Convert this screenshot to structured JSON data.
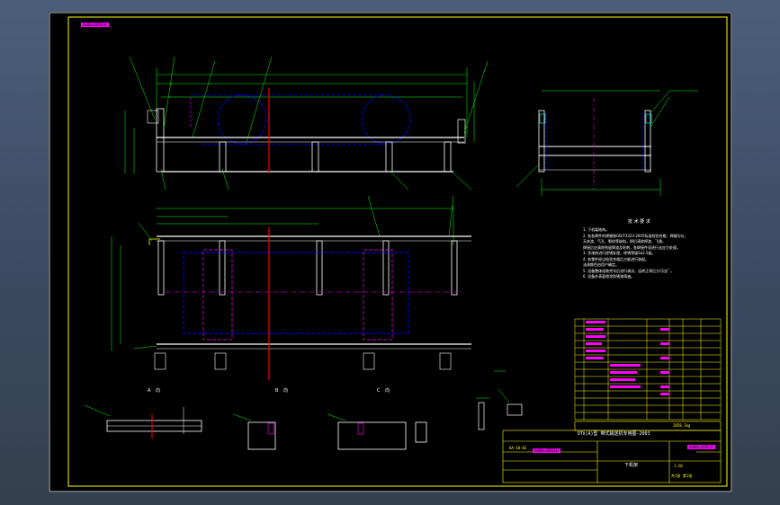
{
  "drawing": {
    "stamp_top_left": "BOOKLINTECH",
    "stamp_bottom_left": "BOOKLINTECH",
    "stamp_title_right": "BOOKLINTECH",
    "stamp_small_left": "6A-10-02",
    "tech_requirements_title": "技 术 要 求",
    "tech_requirements": [
      "1. 下机架结构。",
      "2. 各各焊件的焊缝按GB/T3323-2005标准检验合格；焊缝均匀，",
      "   无夹渣、气孔、裂纹等缺陷，焊后清除焊渣、飞溅，",
      "   焊接后应清除残留焊渣及毛刺，各焊接件须进行去应力处理。",
      "3. 涂漆前进行除锈处理，除锈等级Sa2.5级。",
      "4. 各零件经过检验合格后方能进行装配。",
      "",
      "   油漆颜色由用户确定。",
      "5. 设备整体组装完毕后进行调试，运转正常后方可出厂。",
      "6. 设备外表面喷涂防锈漆两遍。"
    ],
    "title_block": {
      "project": "DTⅡ(A)型  带式输送机专用图-2003",
      "drawing_name": "下机架",
      "scale": "1:20",
      "sheet": "共1张 第1张",
      "weight": "2058.1kg"
    },
    "views": {
      "a": "A 向",
      "b": "B 向",
      "c": "C 向"
    }
  }
}
